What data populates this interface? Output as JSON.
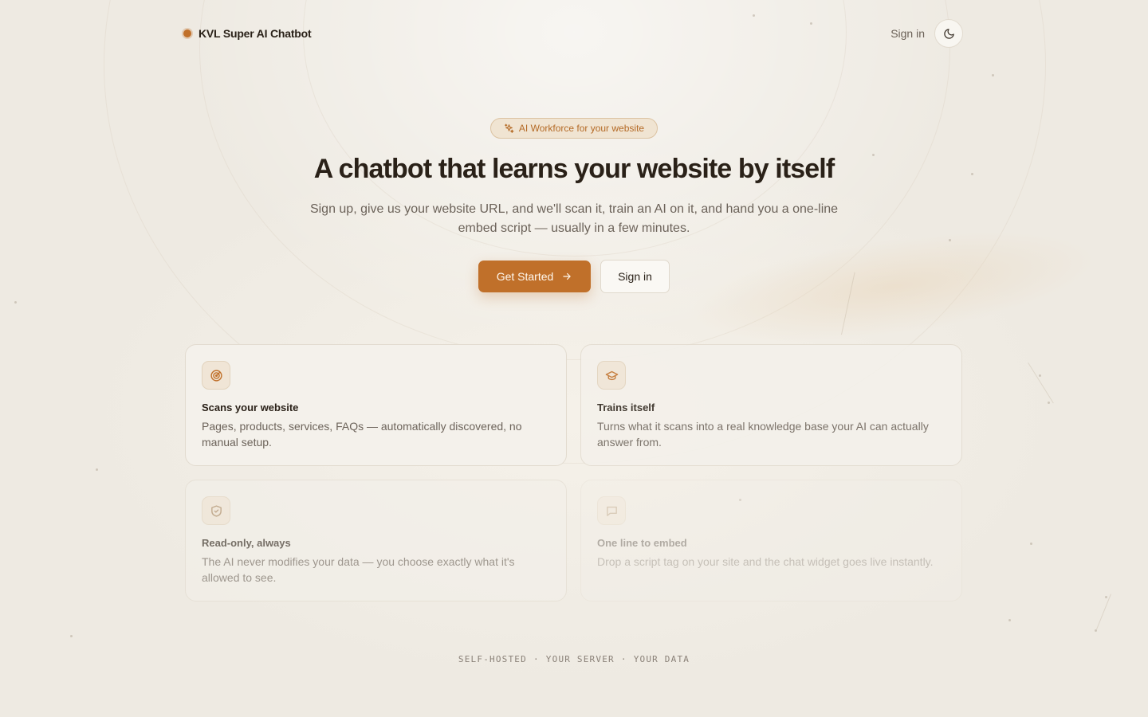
{
  "header": {
    "brand_name": "KVL Super AI Chatbot",
    "brand_color": "#c0702a",
    "signin_label": "Sign in",
    "theme_toggle_icon": "moon-icon"
  },
  "hero": {
    "badge": {
      "icon": "sparkles-icon",
      "label": "AI Workforce for your website"
    },
    "headline": "A chatbot that learns your website by itself",
    "subtitle": "Sign up, give us your website URL, and we'll scan it, train an AI on it, and hand you a one-line embed script — usually in a few minutes.",
    "primary_cta": {
      "label": "Get Started",
      "icon": "arrow-right-icon"
    },
    "secondary_cta": {
      "label": "Sign in"
    }
  },
  "features": [
    {
      "icon": "radar-icon",
      "title": "Scans your website",
      "description": "Pages, products, services, FAQs — automatically discovered, no manual setup."
    },
    {
      "icon": "graduation-cap-icon",
      "title": "Trains itself",
      "description": "Turns what it scans into a real knowledge base your AI can actually answer from."
    },
    {
      "icon": "shield-check-icon",
      "title": "Read-only, always",
      "description": "The AI never modifies your data — you choose exactly what it's allowed to see."
    },
    {
      "icon": "message-square-icon",
      "title": "One line to embed",
      "description": "Drop a script tag on your site and the chat widget goes live instantly."
    }
  ],
  "footer": {
    "tags": [
      "SELF-HOSTED",
      "YOUR SERVER",
      "YOUR DATA"
    ],
    "separator": "·"
  },
  "colors": {
    "accent": "#c0702a",
    "background": "#eeeae2",
    "text": "#2a2118",
    "muted_text": "#6c635a"
  }
}
